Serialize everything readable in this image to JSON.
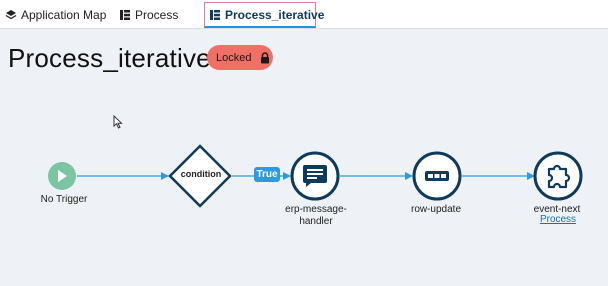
{
  "tabs": [
    {
      "label": "Application Map",
      "icon": "layers-icon"
    },
    {
      "label": "Process",
      "icon": "process-icon"
    },
    {
      "label": "Process_iterative",
      "icon": "process-icon",
      "active": true
    }
  ],
  "page": {
    "title": "Process_iterative",
    "status_badge": "Locked",
    "status_color": "#f07066"
  },
  "flow": {
    "trigger": {
      "label": "No Trigger",
      "color": "#7cc5a0"
    },
    "condition": {
      "label": "condition"
    },
    "edge_label": "True",
    "nodes": [
      {
        "label": "erp-message-handler",
        "label_line1": "erp-message-",
        "label_line2": "handler",
        "icon": "message-icon"
      },
      {
        "label": "row-update",
        "icon": "row-icon"
      },
      {
        "label": "event-next",
        "icon": "puzzle-icon",
        "link": "Process"
      }
    ],
    "node_stroke": "#0e3b5b",
    "edge_color": "#2d9be0"
  }
}
